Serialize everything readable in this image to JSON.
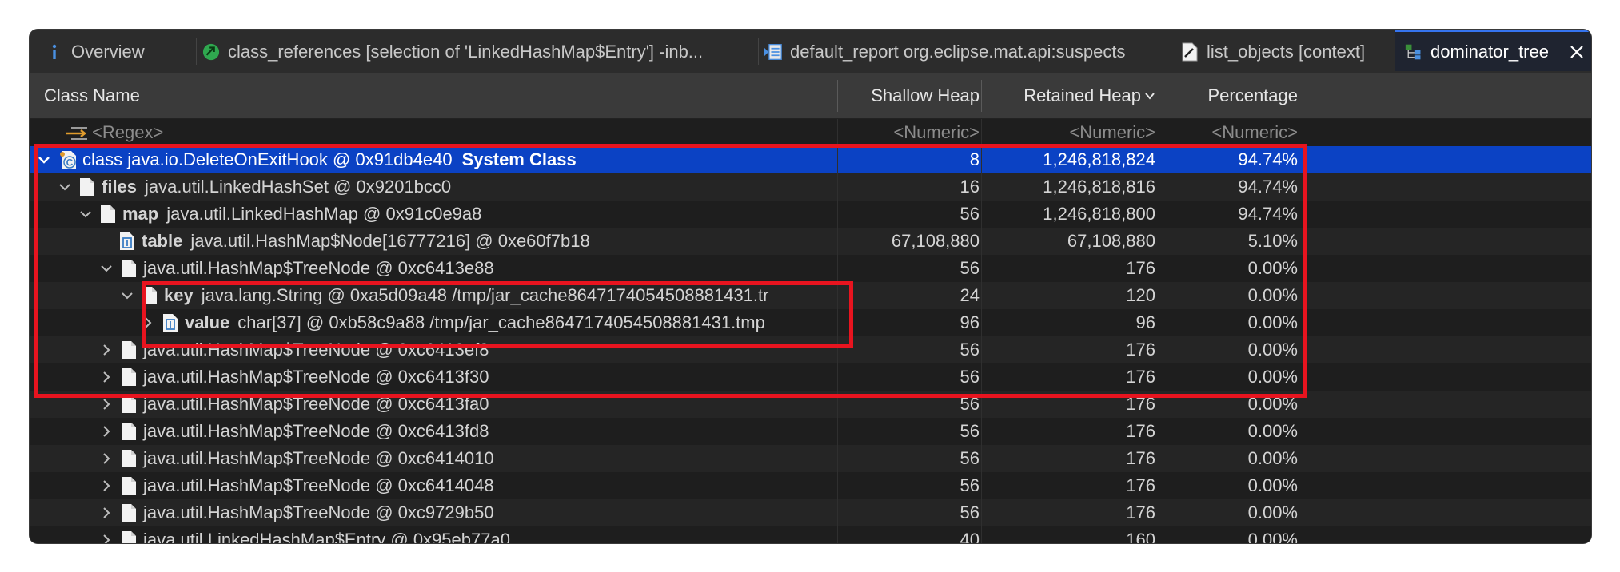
{
  "tabs": [
    {
      "label": "Overview",
      "icon": "info-icon"
    },
    {
      "label": "class_references [selection of 'LinkedHashMap$Entry'] -inb...",
      "icon": "class-references-icon"
    },
    {
      "label": "default_report org.eclipse.mat.api:suspects",
      "icon": "report-icon"
    },
    {
      "label": "list_objects [context]",
      "icon": "list-objects-icon"
    },
    {
      "label": "dominator_tree",
      "icon": "dominator-tree-icon",
      "active": true
    }
  ],
  "columns": {
    "class_name": "Class Name",
    "shallow_heap": "Shallow Heap",
    "retained_heap": "Retained Heap",
    "percentage": "Percentage"
  },
  "filter": {
    "class_name": "<Regex>",
    "shallow_heap": "<Numeric>",
    "retained_heap": "<Numeric>",
    "percentage": "<Numeric>"
  },
  "rows": [
    {
      "field": "",
      "text": "class java.io.DeleteOnExitHook @ 0x91db4e40",
      "suffix": "System Class",
      "shallow": "8",
      "retained": "1,246,818,824",
      "pct": "94.74%"
    },
    {
      "field": "files",
      "text": "java.util.LinkedHashSet @ 0x9201bcc0",
      "suffix": "",
      "shallow": "16",
      "retained": "1,246,818,816",
      "pct": "94.74%"
    },
    {
      "field": "map",
      "text": "java.util.LinkedHashMap @ 0x91c0e9a8",
      "suffix": "",
      "shallow": "56",
      "retained": "1,246,818,800",
      "pct": "94.74%"
    },
    {
      "field": "table",
      "text": "java.util.HashMap$Node[16777216] @ 0xe60f7b18",
      "suffix": "",
      "shallow": "67,108,880",
      "retained": "67,108,880",
      "pct": "5.10%"
    },
    {
      "field": "",
      "text": "java.util.HashMap$TreeNode @ 0xc6413e88",
      "suffix": "",
      "shallow": "56",
      "retained": "176",
      "pct": "0.00%"
    },
    {
      "field": "key",
      "text": "java.lang.String @ 0xa5d09a48  /tmp/jar_cache8647174054508881431.tr",
      "suffix": "",
      "shallow": "24",
      "retained": "120",
      "pct": "0.00%"
    },
    {
      "field": "value",
      "text": "char[37] @ 0xb58c9a88  /tmp/jar_cache8647174054508881431.tmp",
      "suffix": "",
      "shallow": "96",
      "retained": "96",
      "pct": "0.00%"
    },
    {
      "field": "",
      "text": "java.util.HashMap$TreeNode @ 0xc6413ef8",
      "suffix": "",
      "shallow": "56",
      "retained": "176",
      "pct": "0.00%"
    },
    {
      "field": "",
      "text": "java.util.HashMap$TreeNode @ 0xc6413f30",
      "suffix": "",
      "shallow": "56",
      "retained": "176",
      "pct": "0.00%"
    },
    {
      "field": "",
      "text": "java.util.HashMap$TreeNode @ 0xc6413fa0",
      "suffix": "",
      "shallow": "56",
      "retained": "176",
      "pct": "0.00%"
    },
    {
      "field": "",
      "text": "java.util.HashMap$TreeNode @ 0xc6413fd8",
      "suffix": "",
      "shallow": "56",
      "retained": "176",
      "pct": "0.00%"
    },
    {
      "field": "",
      "text": "java.util.HashMap$TreeNode @ 0xc6414010",
      "suffix": "",
      "shallow": "56",
      "retained": "176",
      "pct": "0.00%"
    },
    {
      "field": "",
      "text": "java.util.HashMap$TreeNode @ 0xc6414048",
      "suffix": "",
      "shallow": "56",
      "retained": "176",
      "pct": "0.00%"
    },
    {
      "field": "",
      "text": "java.util.HashMap$TreeNode @ 0xc9729b50",
      "suffix": "",
      "shallow": "56",
      "retained": "176",
      "pct": "0.00%"
    },
    {
      "field": "",
      "text": "java.util.LinkedHashMap$Entry @ 0x95eb77a0",
      "suffix": "",
      "shallow": "40",
      "retained": "160",
      "pct": "0.00%"
    }
  ],
  "colors": {
    "selection": "#0b42c4",
    "highlight_box": "#e8141f",
    "accent_tab": "#3574f0"
  }
}
